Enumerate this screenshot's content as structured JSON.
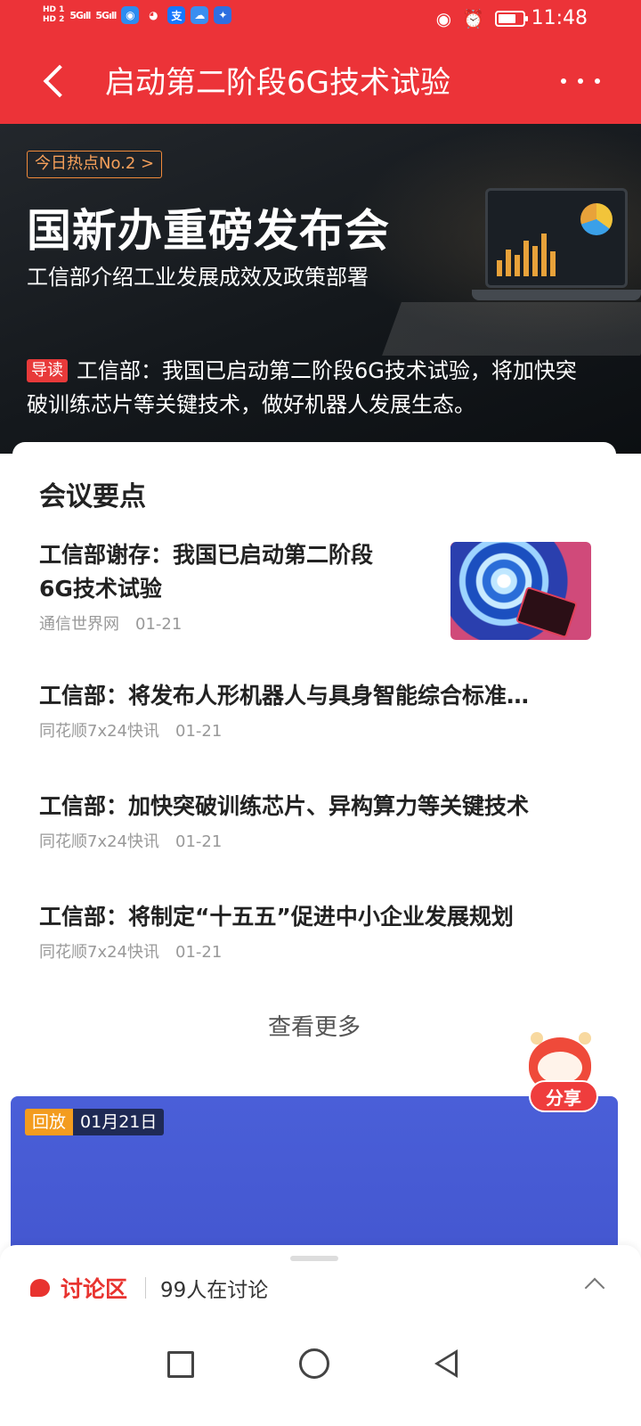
{
  "status_bar": {
    "network_1": "HD 1",
    "network_2": "HD 2",
    "signal_1": "5G",
    "signal_2": "5G",
    "alipay_label": "支",
    "time": "11:48",
    "battery_percent": 75
  },
  "app_bar": {
    "title": "启动第二阶段6G技术试验"
  },
  "hero": {
    "hot_tag": "今日热点No.2 >",
    "title": "国新办重磅发布会",
    "subtitle": "工信部介绍工业发展成效及政策部署",
    "guide_badge": "导读",
    "intro": "工信部：我国已启动第二阶段6G技术试验，将加快突破训练芯片等关键技术，做好机器人发展生态。"
  },
  "card": {
    "title": "会议要点",
    "news": [
      {
        "title_line1": "工信部谢存：我国已启动第二阶段",
        "title_line2": "6G技术试验",
        "source": "通信世界网",
        "date": "01-21"
      },
      {
        "title": "工信部：将发布人形机器人与具身智能综合标准…",
        "source": "同花顺7x24快讯",
        "date": "01-21"
      },
      {
        "title": "工信部：加快突破训练芯片、异构算力等关键技术",
        "source": "同花顺7x24快讯",
        "date": "01-21"
      },
      {
        "title": "工信部：将制定“十五五”促进中小企业发展规划",
        "source": "同花顺7x24快讯",
        "date": "01-21"
      }
    ],
    "see_more": "查看更多"
  },
  "share": {
    "label": "分享"
  },
  "video": {
    "replay_tag": "回放",
    "date": "01月21日"
  },
  "discussion": {
    "label": "讨论区",
    "count_text": "99人在讨论"
  },
  "colors": {
    "brand_red": "#ec3338",
    "hot_orange": "#f08a3a",
    "replay_orange": "#f39c1f",
    "video_blue": "#4a5fd8"
  }
}
